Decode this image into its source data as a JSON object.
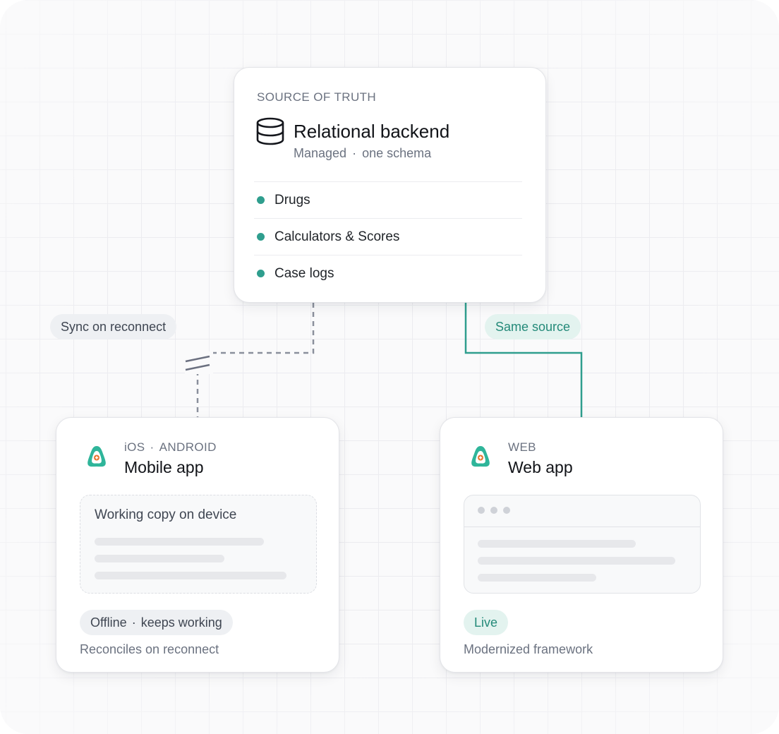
{
  "source": {
    "eyebrow": "SOURCE OF TRUTH",
    "title": "Relational backend",
    "sub_a": "Managed",
    "sub_sep": "·",
    "sub_b": "one schema",
    "icon": "database-icon",
    "entities": [
      {
        "label": "Drugs"
      },
      {
        "label": "Calculators & Scores"
      },
      {
        "label": "Case logs"
      }
    ]
  },
  "edges": {
    "sync_label": "Sync on reconnect",
    "same_label": "Same source"
  },
  "mobile": {
    "platform_a": "iOS",
    "platform_sep": "·",
    "platform_b": "ANDROID",
    "title": "Mobile app",
    "icon": "app-logo-icon",
    "local_title": "Working copy on device",
    "status_a": "Offline",
    "status_sep": "·",
    "status_b": "keeps working",
    "note": "Reconciles on reconnect"
  },
  "web": {
    "platform": "WEB",
    "title": "Web app",
    "icon": "app-logo-icon",
    "status": "Live",
    "note": "Modernized framework"
  },
  "colors": {
    "accent": "#2f9e8e",
    "dashed_line": "#8a8f9c",
    "pill_grey": "#eef0f3",
    "pill_green": "#e3f3ef"
  }
}
